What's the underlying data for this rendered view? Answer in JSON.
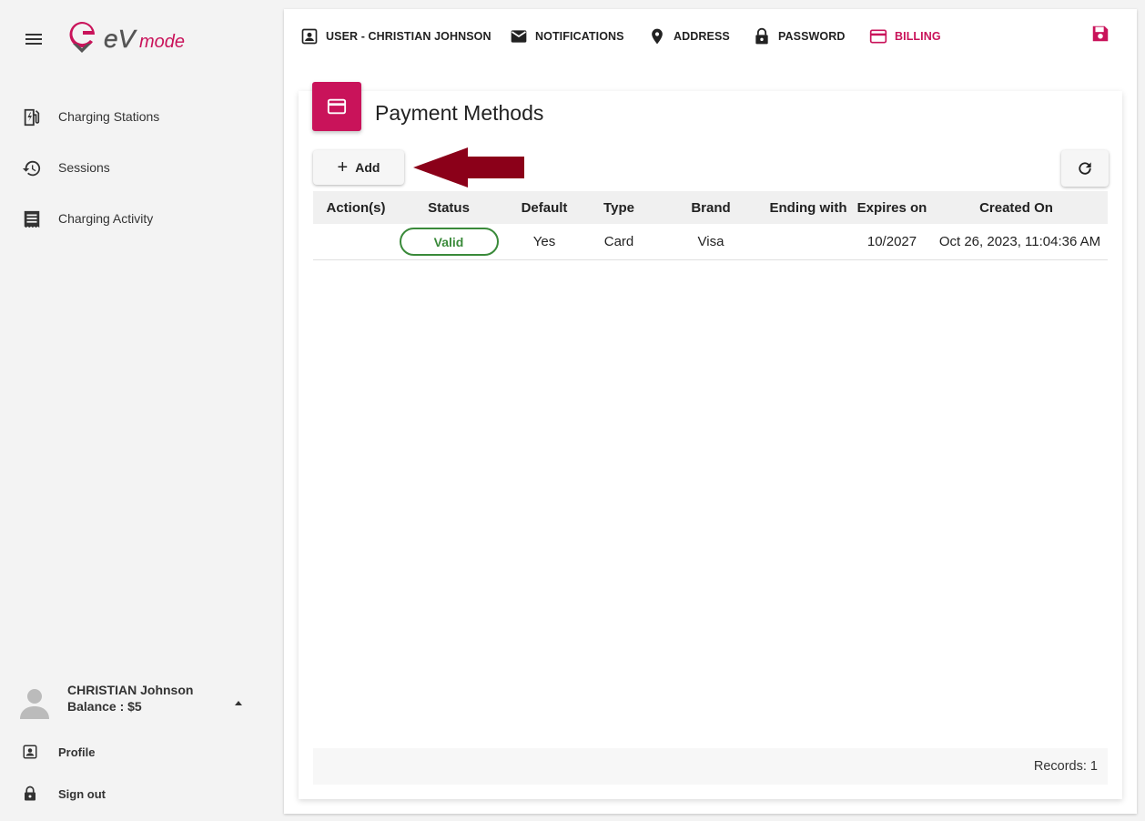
{
  "sidebar": {
    "logo_text": "eVmode",
    "items": [
      {
        "label": "Charging Stations",
        "icon": "ev-station-icon"
      },
      {
        "label": "Sessions",
        "icon": "history-icon"
      },
      {
        "label": "Charging Activity",
        "icon": "receipt-icon"
      }
    ],
    "user": {
      "name": "CHRISTIAN Johnson",
      "balance": "Balance : $5"
    },
    "footer_items": [
      {
        "label": "Profile",
        "icon": "account-box-icon"
      },
      {
        "label": "Sign out",
        "icon": "lock-icon"
      }
    ]
  },
  "tabs": [
    {
      "label": "USER - CHRISTIAN JOHNSON",
      "icon": "account-box-icon"
    },
    {
      "label": "NOTIFICATIONS",
      "icon": "mail-icon"
    },
    {
      "label": "ADDRESS",
      "icon": "location-pin-icon"
    },
    {
      "label": "PASSWORD",
      "icon": "lock-icon"
    },
    {
      "label": "BILLING",
      "icon": "credit-card-icon",
      "active": true
    }
  ],
  "panel": {
    "title": "Payment Methods",
    "add_label": "Add"
  },
  "table": {
    "columns": [
      "Action(s)",
      "Status",
      "Default",
      "Type",
      "Brand",
      "Ending with",
      "Expires on",
      "Created On"
    ],
    "rows": [
      {
        "actions": "",
        "status": "Valid",
        "default": "Yes",
        "type": "Card",
        "brand": "Visa",
        "ending_with": "",
        "expires_on": "10/2027",
        "created_on": "Oct 26, 2023, 11:04:36 AM"
      }
    ]
  },
  "footer": {
    "records": "Records: 1"
  },
  "colors": {
    "accent": "#c9135a",
    "valid_green": "#3a8a3a",
    "arrow": "#8b0019"
  }
}
